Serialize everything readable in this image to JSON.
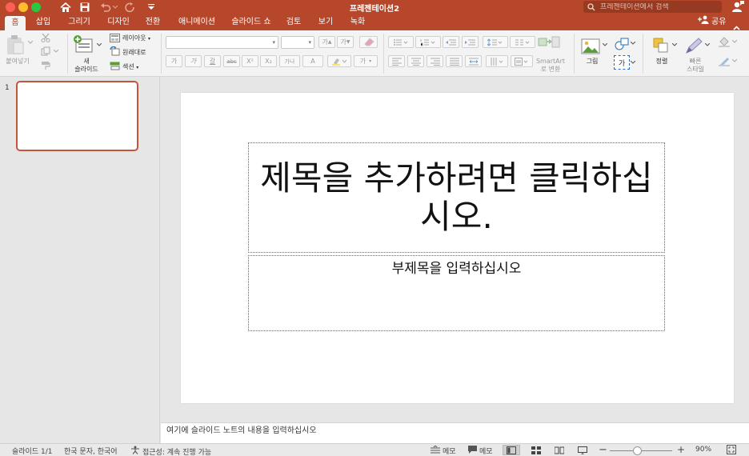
{
  "window": {
    "title": "프레젠테이션2",
    "search_placeholder": "프레젠테이션에서 검색"
  },
  "tabs": [
    {
      "label": "홈",
      "active": true
    },
    {
      "label": "삽입"
    },
    {
      "label": "그리기"
    },
    {
      "label": "디자인"
    },
    {
      "label": "전환"
    },
    {
      "label": "애니메이션"
    },
    {
      "label": "슬라이드 쇼"
    },
    {
      "label": "검토"
    },
    {
      "label": "보기"
    },
    {
      "label": "녹화"
    }
  ],
  "share_label": "공유",
  "ribbon": {
    "paste_label": "붙여넣기",
    "new_slide_label_1": "새",
    "new_slide_label_2": "슬라이드",
    "layout_label": "레이아웃",
    "reset_label": "원래대로",
    "section_label": "섹션",
    "font_buttons": [
      "가",
      "가",
      "갈",
      "abc",
      "X²",
      "X₂",
      "가나",
      "A"
    ],
    "grow_font": "가",
    "shrink_font": "가",
    "char_spacing": "가",
    "smartart_label_1": "SmartArt",
    "smartart_label_2": "로 변환",
    "picture_label": "그림",
    "textbox_icon_text": "가",
    "arrange_label": "정렬",
    "quick_styles_label_1": "빠른",
    "quick_styles_label_2": "스타일"
  },
  "thumbnails": [
    {
      "number": "1"
    }
  ],
  "slide": {
    "title_placeholder": "제목을 추가하려면 클릭하십시오.",
    "subtitle_placeholder": "부제목을 입력하십시오"
  },
  "notes_placeholder": "여기에 슬라이드 노트의 내용을 입력하십시오",
  "statusbar": {
    "slide_info": "슬라이드 1/1",
    "language": "한국 문자, 한국어",
    "accessibility": "접근성: 계속 진행 가능",
    "notes_label": "메모",
    "comments_label": "메모",
    "zoom_percent": "90%",
    "zoom_value": 90
  },
  "colors": {
    "accent": "#b7472a",
    "thumb_border": "#c0573b"
  }
}
